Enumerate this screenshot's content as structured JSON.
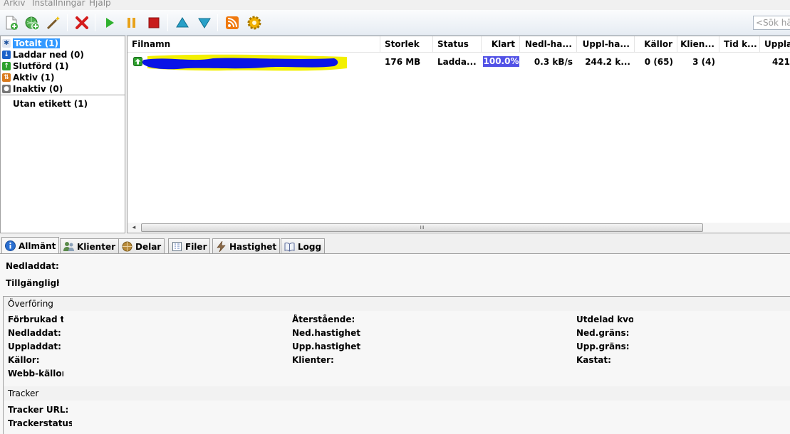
{
  "menu": {
    "file": "Arkiv",
    "settings": "Inställningar",
    "help": "Hjälp"
  },
  "toolbar": {
    "buttons": [
      {
        "icon": "add-torrent-icon"
      },
      {
        "icon": "add-url-icon"
      },
      {
        "icon": "create-torrent-icon"
      },
      {
        "icon": "delete-icon"
      },
      {
        "icon": "start-icon"
      },
      {
        "icon": "pause-icon"
      },
      {
        "icon": "stop-icon"
      },
      {
        "icon": "queue-up-icon"
      },
      {
        "icon": "queue-down-icon"
      },
      {
        "icon": "rss-icon"
      },
      {
        "icon": "preferences-icon"
      }
    ],
    "search_placeholder": "<Sök hä"
  },
  "sidebar": {
    "categories": [
      {
        "label": "Totalt (1)",
        "icon": "all-icon",
        "color": "#1b4f9c",
        "selected": true
      },
      {
        "label": "Laddar ned (0)",
        "icon": "downloading-icon",
        "color": "#1b62c9"
      },
      {
        "label": "Slutförd (1)",
        "icon": "completed-icon",
        "color": "#2ea12e"
      },
      {
        "label": "Aktiv (1)",
        "icon": "active-icon",
        "color": "#d97a1c"
      },
      {
        "label": "Inaktiv (0)",
        "icon": "inactive-icon",
        "color": "#777777"
      }
    ],
    "labels": [
      {
        "label": "Utan etikett (1)"
      }
    ]
  },
  "list": {
    "columns": [
      "Filnamn",
      "Storlek",
      "Status",
      "Klart",
      "Nedl-ha...",
      "Uppl-ha...",
      "Källor",
      "Klien...",
      "Tid k...",
      "Uppla"
    ],
    "rows": [
      {
        "name": "",
        "size": "176 MB",
        "status": "Ladda...",
        "done": "100.0%",
        "done_fraction": 1.0,
        "down": "0.3 kB/s",
        "up": "244.2 k...",
        "sources": "0 (65)",
        "peers": "3 (4)",
        "eta": "",
        "uploaded": "421"
      }
    ],
    "scroll_thumb": "III"
  },
  "tabs": [
    {
      "label": "Allmänt",
      "icon": "info-icon",
      "active": true
    },
    {
      "label": "Klienter",
      "icon": "peers-icon"
    },
    {
      "label": "Delar",
      "icon": "pieces-icon"
    },
    {
      "label": "Filer",
      "icon": "files-icon"
    },
    {
      "label": "Hastighet",
      "icon": "speed-icon"
    },
    {
      "label": "Logg",
      "icon": "log-icon"
    }
  ],
  "general": {
    "downloaded": "Nedladdat:",
    "availability": "Tillgänglighet",
    "transfer": {
      "title": "Överföring",
      "col1": [
        "Förbrukad ti",
        "Nedladdat:",
        "Uppladdat:",
        "Källor:",
        "Webb-källor"
      ],
      "col2": [
        "Återstående:",
        "Ned.hastighet",
        "Upp.hastighet",
        "Klienter:"
      ],
      "col3": [
        "Utdelad kvo",
        "Ned.gräns:",
        "Upp.gräns:",
        "Kastat:"
      ]
    },
    "tracker": {
      "title": "Tracker",
      "fields": [
        "Tracker URL:",
        "Trackerstatus"
      ]
    }
  },
  "colors": {
    "selection": "#3399ff",
    "progress": "#5252e6",
    "redaction_blue": "#0a14e6",
    "redaction_yellow": "#f3f000"
  }
}
